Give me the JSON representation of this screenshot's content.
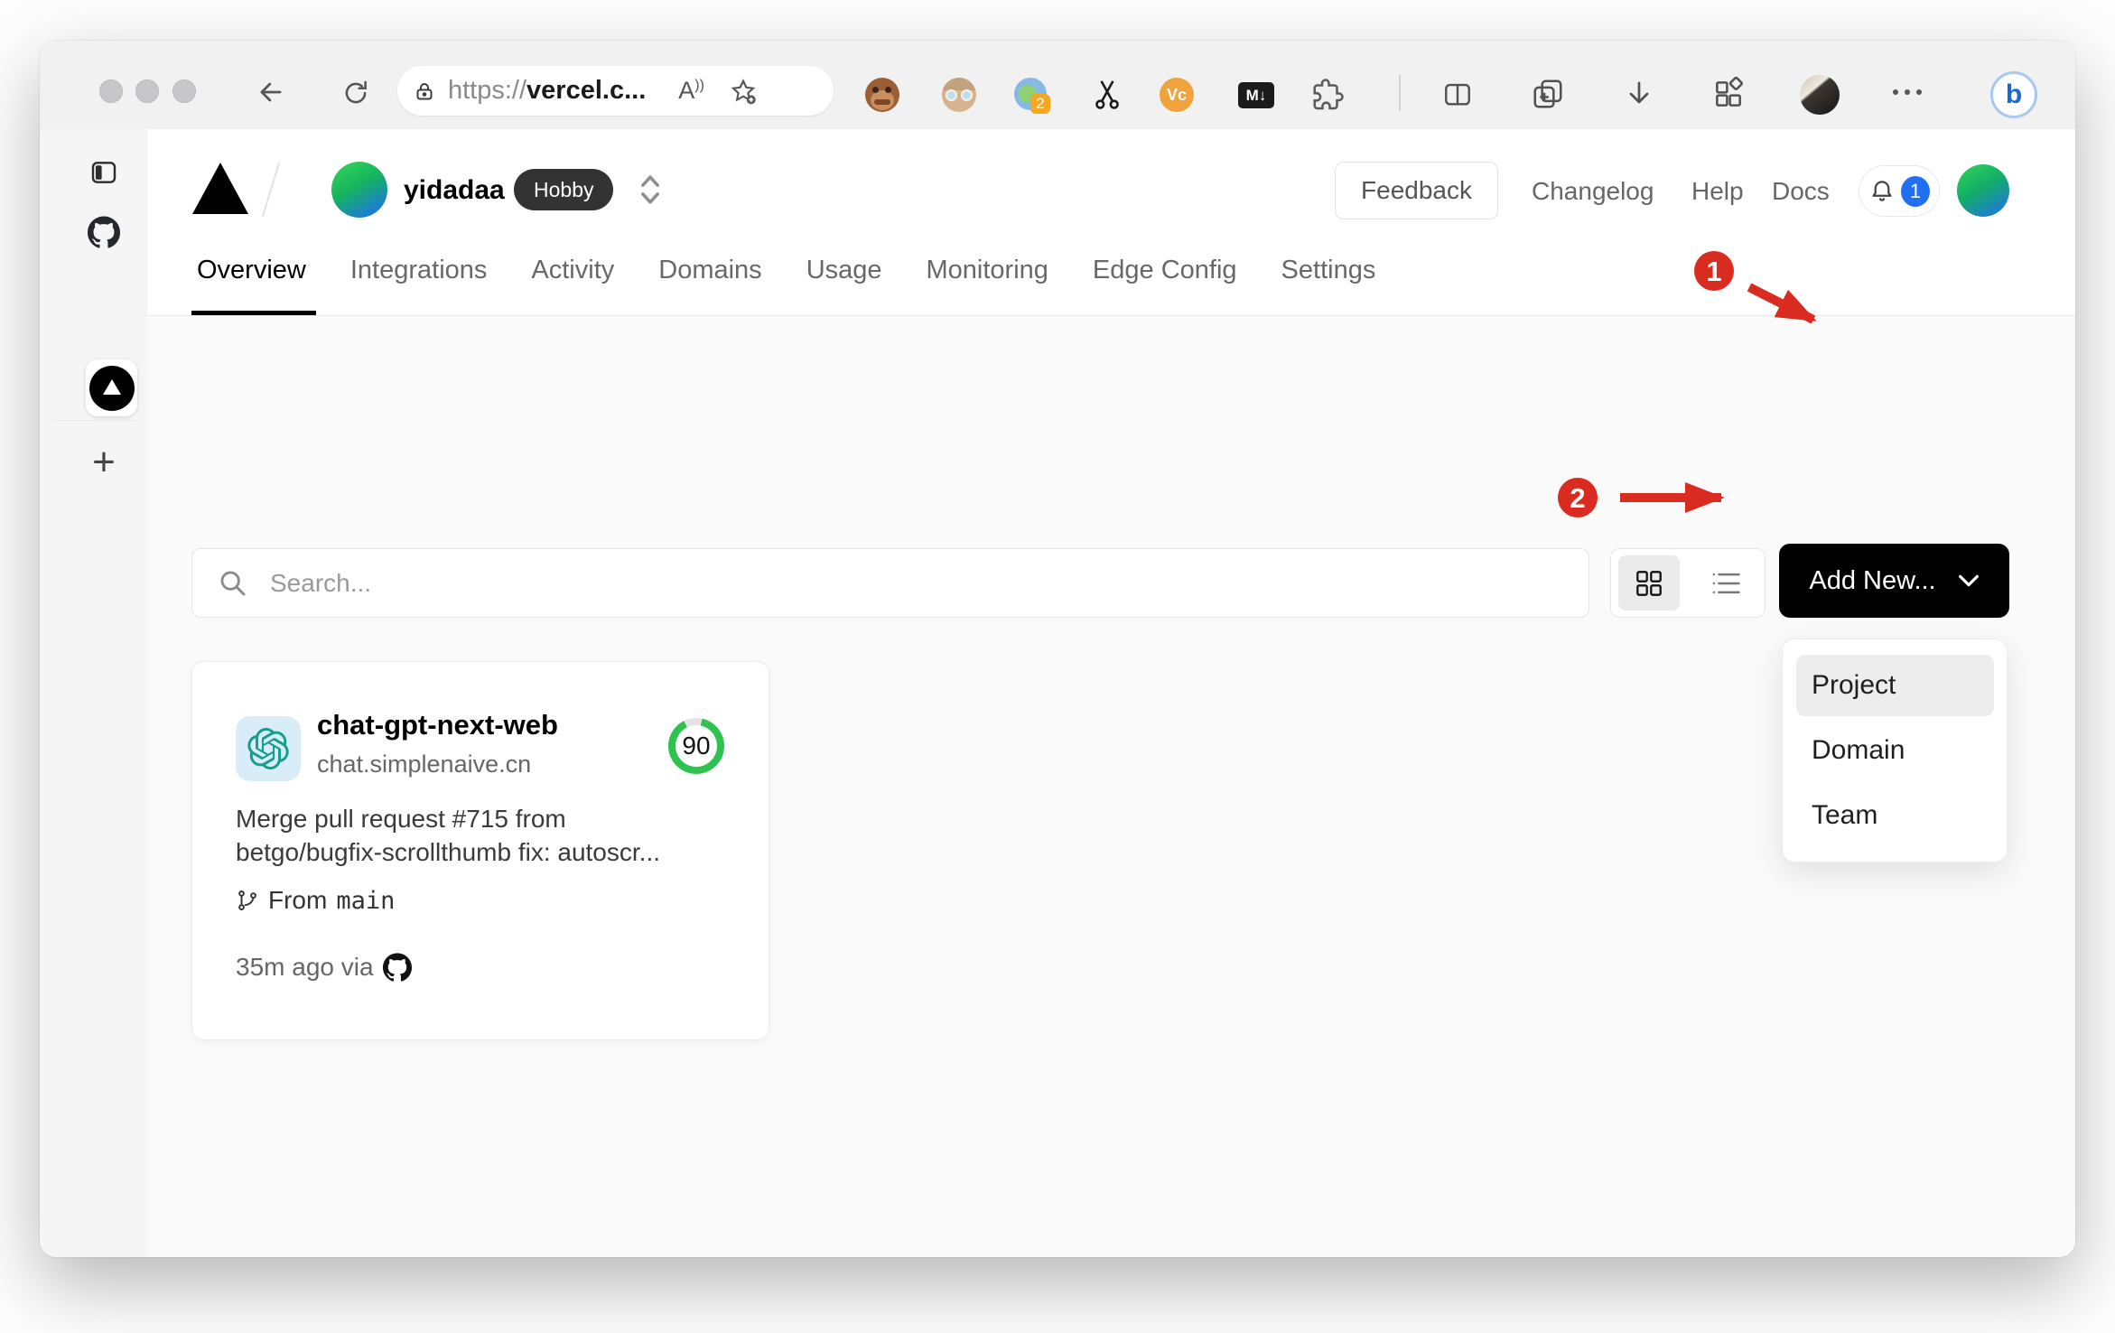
{
  "browser": {
    "url": {
      "scheme": "https://",
      "host": "vercel.c..."
    },
    "reader_label": "A",
    "extensions": {
      "translate_badge": "2",
      "vc_label": "Vc",
      "markdown_label": "M↓"
    }
  },
  "vercel": {
    "team": {
      "name": "yidadaa",
      "plan": "Hobby"
    },
    "header_links": {
      "feedback": "Feedback",
      "changelog": "Changelog",
      "help": "Help",
      "docs": "Docs"
    },
    "notifications": {
      "count": "1"
    },
    "tabs": {
      "active": "Overview",
      "items": [
        {
          "label": "Overview"
        },
        {
          "label": "Integrations"
        },
        {
          "label": "Activity"
        },
        {
          "label": "Domains"
        },
        {
          "label": "Usage"
        },
        {
          "label": "Monitoring"
        },
        {
          "label": "Edge Config"
        },
        {
          "label": "Settings"
        }
      ]
    },
    "toolbar": {
      "search_placeholder": "Search...",
      "add_new": "Add New..."
    },
    "dropdown": {
      "highlighted": "Project",
      "items": [
        {
          "label": "Project"
        },
        {
          "label": "Domain"
        },
        {
          "label": "Team"
        }
      ]
    },
    "project_card": {
      "name": "chat-gpt-next-web",
      "domain": "chat.simplenaive.cn",
      "score": "90",
      "commit_line1": "Merge pull request #715 from",
      "commit_line2": "betgo/bugfix-scrollthumb fix: autoscr...",
      "branch_prefix": "From",
      "branch": "main",
      "deployed": "35m ago via"
    }
  },
  "annotations": {
    "step1": "1",
    "step2": "2"
  },
  "colors": {
    "annotation_red": "#d92b1f",
    "score_green": "#2ec24e",
    "badge_blue": "#1f6ff2",
    "button_black": "#000000"
  }
}
